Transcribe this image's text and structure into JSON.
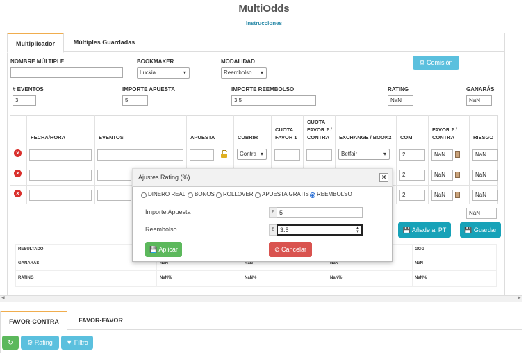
{
  "app": {
    "title": "MultiOdds",
    "instructions_link": "Instrucciones"
  },
  "tabs": [
    {
      "label": "Multiplicador",
      "active": true
    },
    {
      "label": "Múltiples Guardadas",
      "active": false
    }
  ],
  "form": {
    "nombre_label": "NOMBRE MÚLTIPLE",
    "nombre_value": "",
    "bookmaker_label": "BOOKMAKER",
    "bookmaker_value": "Luckia",
    "modalidad_label": "MODALIDAD",
    "modalidad_value": "Reembolso",
    "comision_button": "Comisión",
    "eventos_label": "# EVENTOS",
    "eventos_value": "3",
    "importe_label": "IMPORTE APUESTA",
    "importe_value": "5",
    "reembolso_label": "IMPORTE REEMBOLSO",
    "reembolso_value": "3.5",
    "rating_label": "RATING",
    "rating_value": "NaN",
    "ganaras_label": "GANARÁS",
    "ganaras_value": "NaN"
  },
  "table": {
    "headers": [
      "FECHA/HORA",
      "EVENTOS",
      "APUESTA",
      "CUBRIR",
      "CUOTA FAVOR 1",
      "CUOTA FAVOR 2 / CONTRA",
      "EXCHANGE / BOOK2",
      "COM",
      "FAVOR 2 / CONTRA",
      "RIESGO"
    ],
    "rows": [
      {
        "cubrir": "Contra",
        "exchange": "Betfair",
        "com": "2",
        "favor2": "NaN",
        "riesgo": "NaN"
      },
      {
        "cubrir": "",
        "exchange": "",
        "com": "2",
        "favor2": "NaN",
        "riesgo": "NaN"
      },
      {
        "cubrir": "",
        "exchange": "",
        "com": "2",
        "favor2": "NaN",
        "riesgo": "NaN"
      }
    ],
    "total_riesgo": "NaN"
  },
  "actions": {
    "add_pt": "Añade al PT",
    "save": "Guardar"
  },
  "results": {
    "headers": [
      "RESULTADO",
      "",
      "",
      "",
      "GGG"
    ],
    "rows": [
      {
        "label": "GANARÁS",
        "values": [
          "NaN",
          "NaN",
          "NaN",
          "NaN"
        ]
      },
      {
        "label": "RATING",
        "values": [
          "NaN%",
          "NaN%",
          "NaN%",
          "NaN%"
        ]
      }
    ]
  },
  "bottom_tabs": [
    {
      "label": "FAVOR-CONTRA",
      "active": true
    },
    {
      "label": "FAVOR-FAVOR",
      "active": false
    }
  ],
  "toolbar": {
    "rating": "Rating",
    "filtro": "Filtro"
  },
  "modal": {
    "title": "Ajustes Rating (%)",
    "close": "×",
    "options": [
      {
        "label": "DINERO REAL",
        "checked": false
      },
      {
        "label": "BONOS",
        "checked": false
      },
      {
        "label": "ROLLOVER",
        "checked": false
      },
      {
        "label": "APUESTA GRATIS",
        "checked": false
      },
      {
        "label": "REEMBOLSO",
        "checked": true
      }
    ],
    "importe_label": "Importe Apuesta",
    "importe_value": "5",
    "reembolso_label": "Reembolso",
    "reembolso_value": "3.5",
    "currency": "€",
    "apply": "Aplicar",
    "cancel": "Cancelar"
  },
  "colors": {
    "accent": "#5bc0de",
    "teal": "#17a2b8",
    "green": "#5cb85c",
    "red": "#d9534f",
    "tab_active_border": "#f0ad4e"
  }
}
